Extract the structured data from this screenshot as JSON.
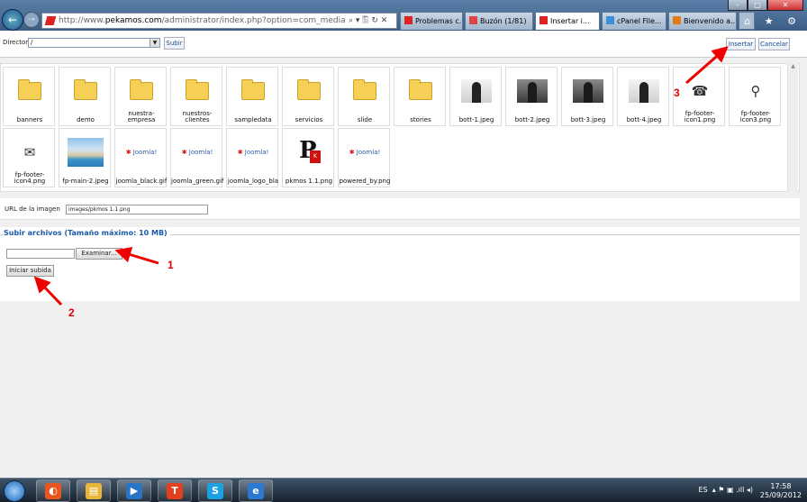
{
  "browser": {
    "url_prefix": "http://www.",
    "url_domain": "pekamos.com",
    "url_rest": "/administrator/index.php?option=com_media&view=imag",
    "address_controls": "⌕ ▾ 🖺 ↻ ✕",
    "tabs": [
      {
        "label": "Problemas c...",
        "icon_color": "#d22"
      },
      {
        "label": "Buzón (1/81)",
        "icon_color": "#d44"
      },
      {
        "label": "Insertar i...",
        "icon_color": "#d22",
        "active": true
      },
      {
        "label": "cPanel File...",
        "icon_color": "#3a8fd8"
      },
      {
        "label": "Bienvenido a...",
        "icon_color": "#e57a1a"
      }
    ],
    "toolbar_icons": "⌂ ★ ⚙"
  },
  "media_manager": {
    "directory_label": "Directorio",
    "directory_value": "/",
    "up_button": "Subir",
    "insert_button": "Insertar",
    "cancel_button": "Cancelar",
    "items": [
      {
        "name": "banners",
        "kind": "folder"
      },
      {
        "name": "demo",
        "kind": "folder"
      },
      {
        "name": "nuestra-\nempresa",
        "kind": "folder"
      },
      {
        "name": "nuestros-\nclientes",
        "kind": "folder"
      },
      {
        "name": "sampledata",
        "kind": "folder"
      },
      {
        "name": "servicios",
        "kind": "folder"
      },
      {
        "name": "slide",
        "kind": "folder"
      },
      {
        "name": "stories",
        "kind": "folder"
      },
      {
        "name": "bott-1.jpeg",
        "kind": "photo-light"
      },
      {
        "name": "bott-2.jpeg",
        "kind": "photo"
      },
      {
        "name": "bott-3.jpeg",
        "kind": "photo"
      },
      {
        "name": "bott-4.jpeg",
        "kind": "photo-light"
      },
      {
        "name": "fp-footer-\nicon1.png",
        "kind": "glyph",
        "glyph": "☎"
      },
      {
        "name": "fp-footer-\nicon3.png",
        "kind": "glyph",
        "glyph": "⚲"
      },
      {
        "name": "fp-footer-\nicon4.png",
        "kind": "glyph",
        "glyph": "✉"
      },
      {
        "name": "fp-main-2.jpeg",
        "kind": "pool"
      },
      {
        "name": "joomla_black.gif",
        "kind": "joomla"
      },
      {
        "name": "joomla_green.gif",
        "kind": "joomla"
      },
      {
        "name": "joomla_logo_bla",
        "kind": "joomla"
      },
      {
        "name": "pkmos 1.1.png",
        "kind": "pk"
      },
      {
        "name": "powered_by.png",
        "kind": "joomla"
      }
    ],
    "joomla_text": "Joomla!",
    "image_url_label": "URL de la imagen",
    "image_url_value": "images/pkmos 1.1.png",
    "upload_legend": "Subir archivos (Tamaño máximo: 10 MB)",
    "browse_button": "Examinar...",
    "start_upload_button": "Iniciar subida"
  },
  "annotations": [
    "1",
    "2",
    "3"
  ],
  "taskbar": {
    "buttons": [
      {
        "icon": "chrome-like-icon",
        "glyph": "◐",
        "color": "#e8551f"
      },
      {
        "icon": "folder-icon",
        "glyph": "▤",
        "color": "#e9b63a"
      },
      {
        "icon": "media-player-icon",
        "glyph": "▶",
        "color": "#2a74c8"
      },
      {
        "icon": "t-app-icon",
        "glyph": "T",
        "color": "#e2401e"
      },
      {
        "icon": "skype-icon",
        "glyph": "S",
        "color": "#1ba0e2"
      },
      {
        "icon": "internet-explorer-icon",
        "glyph": "e",
        "color": "#2b78d0"
      }
    ],
    "language": "ES",
    "tray_icons": "▴ ⚑ ▣ .ıll ◂)",
    "time": "17:58",
    "date": "25/09/2012"
  }
}
